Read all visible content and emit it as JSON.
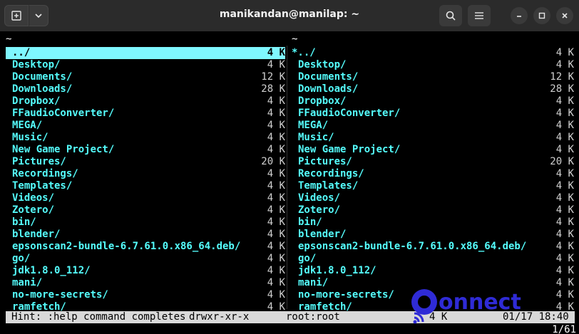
{
  "window": {
    "title": "manikandan@manilap: ~"
  },
  "panes": {
    "left_header": "~",
    "right_header": "~",
    "left": [
      {
        "name": "../",
        "size": "4 K",
        "selected": true
      },
      {
        "name": "Desktop/",
        "size": "4 K"
      },
      {
        "name": "Documents/",
        "size": "12 K"
      },
      {
        "name": "Downloads/",
        "size": "28 K"
      },
      {
        "name": "Dropbox/",
        "size": "4 K"
      },
      {
        "name": "FFaudioConverter/",
        "size": "4 K"
      },
      {
        "name": "MEGA/",
        "size": "4 K"
      },
      {
        "name": "Music/",
        "size": "4 K"
      },
      {
        "name": "New Game Project/",
        "size": "4 K"
      },
      {
        "name": "Pictures/",
        "size": "20 K"
      },
      {
        "name": "Recordings/",
        "size": "4 K"
      },
      {
        "name": "Templates/",
        "size": "4 K"
      },
      {
        "name": "Videos/",
        "size": "4 K"
      },
      {
        "name": "Zotero/",
        "size": "4 K"
      },
      {
        "name": "bin/",
        "size": "4 K"
      },
      {
        "name": "blender/",
        "size": "4 K"
      },
      {
        "name": "epsonscan2-bundle-6.7.61.0.x86_64.deb/",
        "size": "4 K"
      },
      {
        "name": "go/",
        "size": "4 K"
      },
      {
        "name": "jdk1.8.0_112/",
        "size": "4 K"
      },
      {
        "name": "mani/",
        "size": "4 K"
      },
      {
        "name": "no-more-secrets/",
        "size": "4 K"
      },
      {
        "name": "ramfetch/",
        "size": "4 K"
      }
    ],
    "right": [
      {
        "name": "*../",
        "size": "4 K"
      },
      {
        "name": "Desktop/",
        "size": "4 K"
      },
      {
        "name": "Documents/",
        "size": "12 K"
      },
      {
        "name": "Downloads/",
        "size": "28 K"
      },
      {
        "name": "Dropbox/",
        "size": "4 K"
      },
      {
        "name": "FFaudioConverter/",
        "size": "4 K"
      },
      {
        "name": "MEGA/",
        "size": "4 K"
      },
      {
        "name": "Music/",
        "size": "4 K"
      },
      {
        "name": "New Game Project/",
        "size": "4 K"
      },
      {
        "name": "Pictures/",
        "size": "20 K"
      },
      {
        "name": "Recordings/",
        "size": "4 K"
      },
      {
        "name": "Templates/",
        "size": "4 K"
      },
      {
        "name": "Videos/",
        "size": "4 K"
      },
      {
        "name": "Zotero/",
        "size": "4 K"
      },
      {
        "name": "bin/",
        "size": "4 K"
      },
      {
        "name": "blender/",
        "size": "4 K"
      },
      {
        "name": "epsonscan2-bundle-6.7.61.0.x86_64.deb/",
        "size": "4 K"
      },
      {
        "name": "go/",
        "size": "4 K"
      },
      {
        "name": "jdk1.8.0_112/",
        "size": "4 K"
      },
      {
        "name": "mani/",
        "size": "4 K"
      },
      {
        "name": "no-more-secrets/",
        "size": "4 K"
      },
      {
        "name": "ramfetch/",
        "size": "4 K"
      }
    ]
  },
  "status": {
    "hint": "Hint: :help command completes",
    "permissions": "drwxr-xr-x",
    "owner": "root:root",
    "size": "4 K",
    "datetime": "01/17 18:40",
    "pager": "1/61"
  },
  "watermark": {
    "text": "Connect"
  },
  "icons": {
    "new_tab": "new-tab-icon",
    "dropdown": "chevron-down-icon",
    "search": "search-icon",
    "menu": "hamburger-menu-icon",
    "minimize": "minimize-icon",
    "maximize": "maximize-icon",
    "close": "close-icon"
  },
  "colors": {
    "dir": "#55ffff",
    "selection": "#7ff7ff",
    "status_bg": "#d9d9d9",
    "logo": "#2f2bd6"
  }
}
